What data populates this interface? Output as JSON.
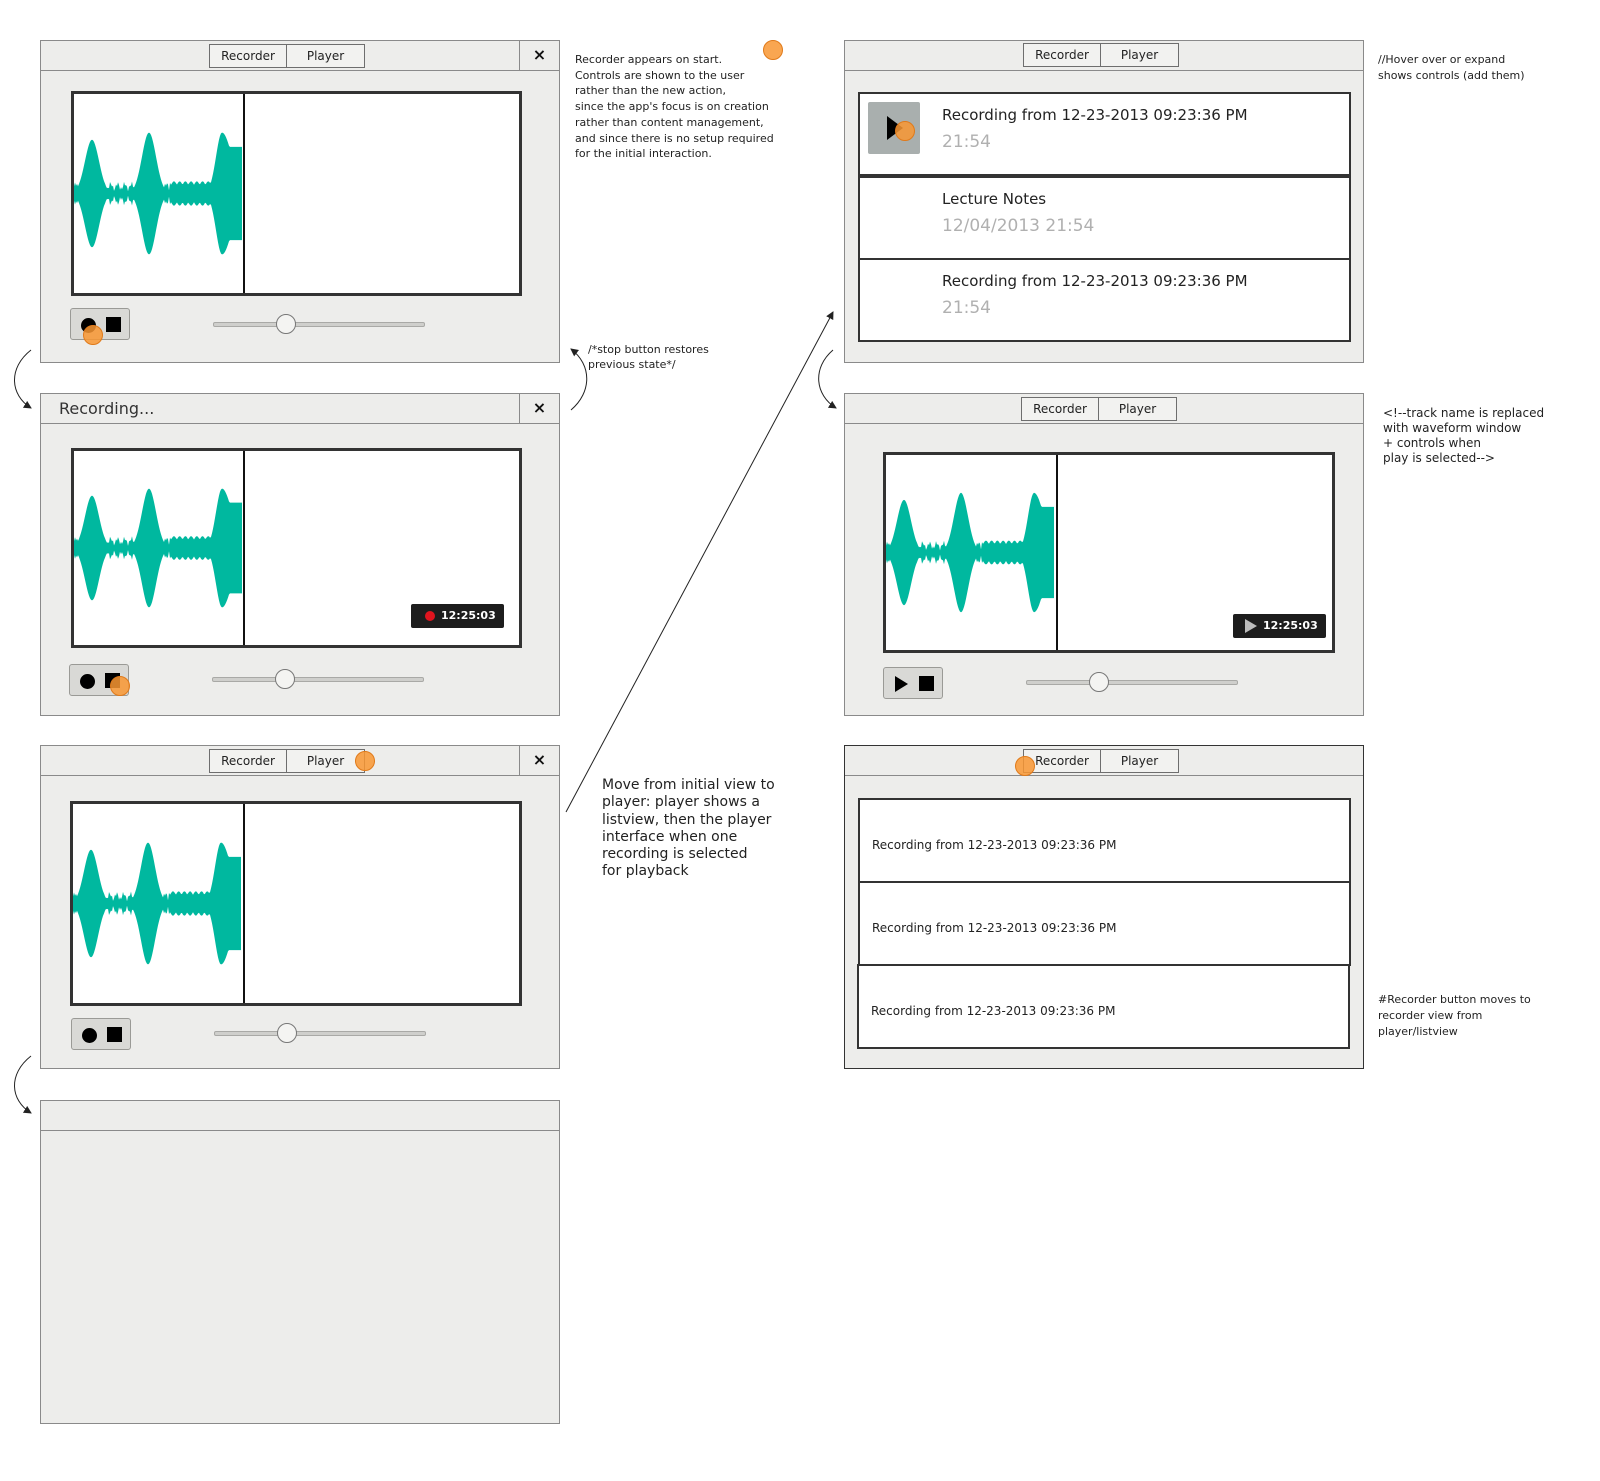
{
  "tabs": {
    "recorder": "Recorder",
    "player": "Player"
  },
  "close_glyph": "×",
  "recording_title": "Recording...",
  "timestamp": "12:25:03",
  "notes": {
    "recorder_start": "Recorder appears on start.\nControls are shown to the user\nrather than the new action,\nsince the app's focus is on creation\nrather than content management,\nand since there is no setup required\nfor the initial interaction.",
    "stop_button": "/*stop button restores\nprevious state*/",
    "move_to_player": "Move from initial view to\nplayer: player shows a\nlistview, then the player\ninterface when one\nrecording is selected\nfor playback",
    "hover_expand": "//Hover over or expand\nshows controls (add them)",
    "track_name": "<!--track name is replaced\nwith waveform window\n+ controls when\nplay is selected-->",
    "recorder_moves": "#Recorder button moves to\nrecorder view from\nplayer/listview"
  },
  "expanded_list": [
    {
      "title": "Recording from  12-23-2013 09:23:36 PM",
      "detail": "21:54"
    },
    {
      "title": "Lecture Notes",
      "detail": "12/04/2013  21:54"
    },
    {
      "title": "Recording from  12-23-2013 09:23:36 PM",
      "detail": "21:54"
    }
  ],
  "simple_list": [
    "Recording from 12-23-2013 09:23:36 PM",
    "Recording from 12-23-2013 09:23:36 PM",
    "Recording from 12-23-2013 09:23:36 PM"
  ],
  "colors": {
    "waveform": "#00b89f",
    "cursor": "#f89632",
    "record_dot": "#e0141e",
    "window_bg": "#ededeb"
  },
  "slider_level": 0.33
}
